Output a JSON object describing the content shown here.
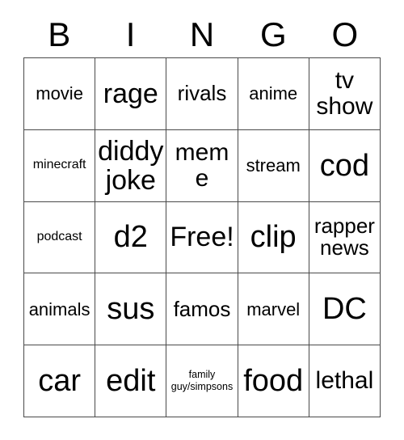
{
  "card": {
    "header_letters": [
      "B",
      "I",
      "N",
      "G",
      "O"
    ],
    "columns": 5,
    "rows": 5,
    "free_space_label": "Free!",
    "free_space_position": {
      "row": 3,
      "column": 3
    },
    "border_color": "#4a4a4a",
    "background_color": "#ffffff",
    "text_color": "#000000"
  },
  "cells": [
    {
      "text": "movie",
      "size": "md"
    },
    {
      "text": "rage",
      "size": "xxl"
    },
    {
      "text": "rivals",
      "size": "lg"
    },
    {
      "text": "anime",
      "size": "md"
    },
    {
      "text": "tv show",
      "size": "xl"
    },
    {
      "text": "minecraft",
      "size": "sm"
    },
    {
      "text": "diddy joke",
      "size": "xxl"
    },
    {
      "text": "meme",
      "size": "xl"
    },
    {
      "text": "stream",
      "size": "md"
    },
    {
      "text": "cod",
      "size": "max"
    },
    {
      "text": "podcast",
      "size": "sm"
    },
    {
      "text": "d2",
      "size": "max"
    },
    {
      "text": "Free!",
      "size": "xxl"
    },
    {
      "text": "clip",
      "size": "max"
    },
    {
      "text": "rapper news",
      "size": "lg"
    },
    {
      "text": "animals",
      "size": "md"
    },
    {
      "text": "sus",
      "size": "max"
    },
    {
      "text": "famos",
      "size": "lg"
    },
    {
      "text": "marvel",
      "size": "md"
    },
    {
      "text": "DC",
      "size": "max"
    },
    {
      "text": "car",
      "size": "max"
    },
    {
      "text": "edit",
      "size": "max"
    },
    {
      "text": "family guy/simpsons",
      "size": "xs"
    },
    {
      "text": "food",
      "size": "max"
    },
    {
      "text": "lethal",
      "size": "xl"
    }
  ]
}
